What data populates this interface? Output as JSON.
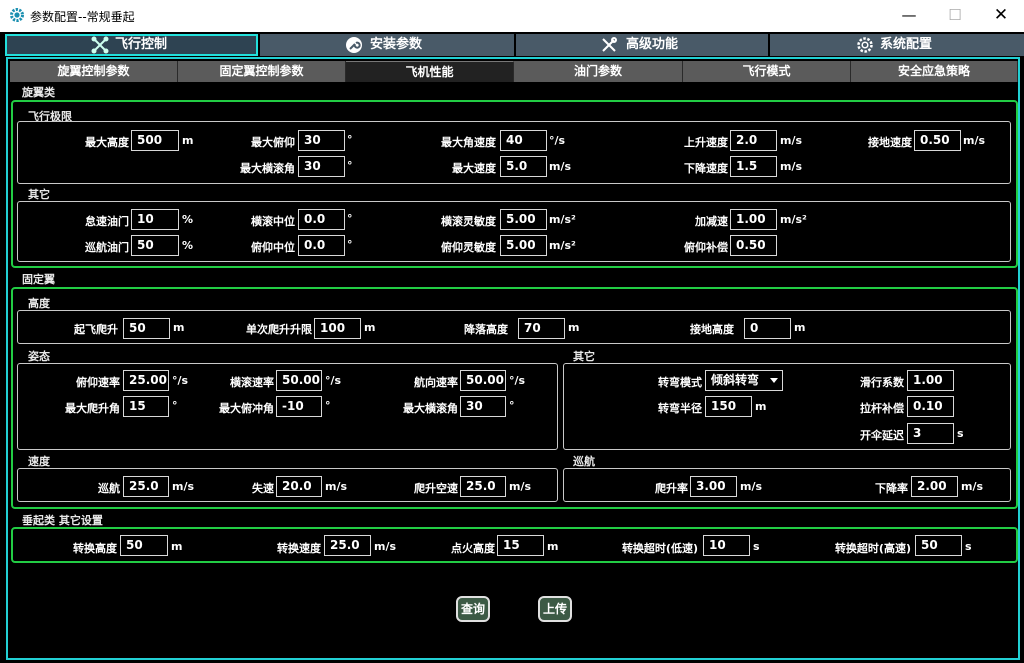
{
  "window": {
    "title": "参数配置--常规垂起",
    "controls": {
      "minimize": "—",
      "maximize": "☐",
      "close": "✕"
    }
  },
  "main_tabs": [
    {
      "label": "飞行控制",
      "icon": "drone-icon"
    },
    {
      "label": "安装参数",
      "icon": "wrench-circle-icon"
    },
    {
      "label": "高级功能",
      "icon": "tools-icon"
    },
    {
      "label": "系统配置",
      "icon": "gear-icon"
    }
  ],
  "sub_tabs": [
    "旋翼控制参数",
    "固定翼控制参数",
    "飞机性能",
    "油门参数",
    "飞行模式",
    "安全应急策略"
  ],
  "rotor": {
    "title": "旋翼类",
    "limits": {
      "title": "飞行极限",
      "max_alt": {
        "label": "最大高度",
        "value": "500",
        "unit": "m"
      },
      "max_pitch": {
        "label": "最大俯仰",
        "value": "30",
        "unit": "°"
      },
      "max_roll": {
        "label": "最大横滚角",
        "value": "30",
        "unit": "°"
      },
      "max_ang_rate": {
        "label": "最大角速度",
        "value": "40",
        "unit": "°/s"
      },
      "max_speed": {
        "label": "最大速度",
        "value": "5.0",
        "unit": "m/s"
      },
      "climb_speed": {
        "label": "上升速度",
        "value": "2.0",
        "unit": "m/s"
      },
      "descent_speed": {
        "label": "下降速度",
        "value": "1.5",
        "unit": "m/s"
      },
      "land_speed": {
        "label": "接地速度",
        "value": "0.50",
        "unit": "m/s"
      }
    },
    "other": {
      "title": "其它",
      "idle_throttle": {
        "label": "怠速油门",
        "value": "10",
        "unit": "%"
      },
      "cruise_throttle": {
        "label": "巡航油门",
        "value": "50",
        "unit": "%"
      },
      "roll_mid": {
        "label": "横滚中位",
        "value": "0.0",
        "unit": "°"
      },
      "pitch_mid": {
        "label": "俯仰中位",
        "value": "0.0",
        "unit": "°"
      },
      "roll_sens": {
        "label": "横滚灵敏度",
        "value": "5.00",
        "unit": "m/s²"
      },
      "pitch_sens": {
        "label": "俯仰灵敏度",
        "value": "5.00",
        "unit": "m/s²"
      },
      "accel": {
        "label": "加减速",
        "value": "1.00",
        "unit": "m/s²"
      },
      "pitch_comp": {
        "label": "俯仰补偿",
        "value": "0.50",
        "unit": ""
      }
    }
  },
  "fixed_wing": {
    "title": "固定翼",
    "altitude": {
      "title": "高度",
      "takeoff_climb": {
        "label": "起飞爬升",
        "value": "50",
        "unit": "m"
      },
      "step_climb": {
        "label": "单次爬升升限",
        "value": "100",
        "unit": "m"
      },
      "landing_alt": {
        "label": "降落高度",
        "value": "70",
        "unit": "m"
      },
      "ground_alt": {
        "label": "接地高度",
        "value": "0",
        "unit": "m"
      }
    },
    "attitude": {
      "title": "姿态",
      "pitch_rate": {
        "label": "俯仰速率",
        "value": "25.00",
        "unit": "°/s"
      },
      "roll_rate": {
        "label": "横滚速率",
        "value": "50.00",
        "unit": "°/s"
      },
      "yaw_rate": {
        "label": "航向速率",
        "value": "50.00",
        "unit": "°/s"
      },
      "max_climb": {
        "label": "最大爬升角",
        "value": "15",
        "unit": "°"
      },
      "max_dive": {
        "label": "最大俯冲角",
        "value": "-10",
        "unit": "°"
      },
      "max_roll": {
        "label": "最大横滚角",
        "value": "30",
        "unit": "°"
      }
    },
    "other": {
      "title": "其它",
      "turn_mode": {
        "label": "转弯模式",
        "value": "倾斜转弯"
      },
      "turn_radius": {
        "label": "转弯半径",
        "value": "150",
        "unit": "m"
      },
      "glide": {
        "label": "滑行系数",
        "value": "1.00"
      },
      "pull_comp": {
        "label": "拉杆补偿",
        "value": "0.10"
      },
      "chute_delay": {
        "label": "开伞延迟",
        "value": "3",
        "unit": "s"
      }
    },
    "speed": {
      "title": "速度",
      "cruise": {
        "label": "巡航",
        "value": "25.0",
        "unit": "m/s"
      },
      "stall": {
        "label": "失速",
        "value": "20.0",
        "unit": "m/s"
      },
      "climb_airspeed": {
        "label": "爬升空速",
        "value": "25.0",
        "unit": "m/s"
      }
    },
    "cruise": {
      "title": "巡航",
      "climb_rate": {
        "label": "爬升率",
        "value": "3.00",
        "unit": "m/s"
      },
      "sink_rate": {
        "label": "下降率",
        "value": "2.00",
        "unit": "m/s"
      }
    }
  },
  "vtol": {
    "title": "垂起类 其它设置",
    "trans_alt": {
      "label": "转换高度",
      "value": "50",
      "unit": "m"
    },
    "trans_speed": {
      "label": "转换速度",
      "value": "25.0",
      "unit": "m/s"
    },
    "ignite_alt": {
      "label": "点火高度",
      "value": "15",
      "unit": "m"
    },
    "timeout_low": {
      "label": "转换超时(低速)",
      "value": "10",
      "unit": "s"
    },
    "timeout_high": {
      "label": "转换超时(高速)",
      "value": "50",
      "unit": "s"
    }
  },
  "buttons": {
    "query": "查询",
    "upload": "上传"
  }
}
